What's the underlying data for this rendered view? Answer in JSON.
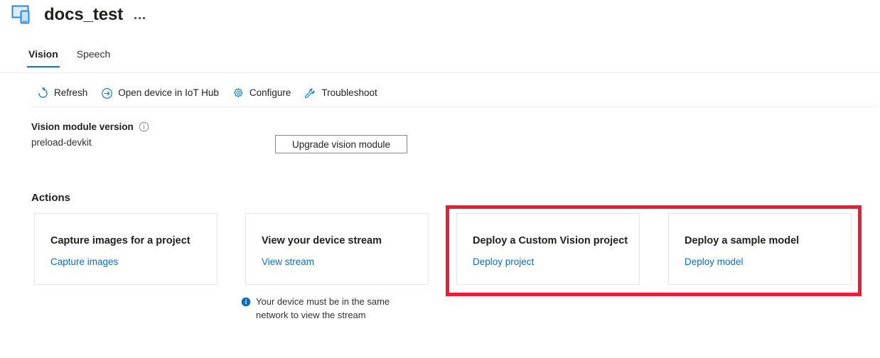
{
  "header": {
    "title": "docs_test",
    "icon": "device-screens-icon",
    "overflow_menu_label": "..."
  },
  "tabs": [
    {
      "label": "Vision",
      "active": true
    },
    {
      "label": "Speech",
      "active": false
    }
  ],
  "commandbar": [
    {
      "label": "Refresh",
      "icon": "refresh-icon"
    },
    {
      "label": "Open device in IoT Hub",
      "icon": "arrow-right-circle-icon"
    },
    {
      "label": "Configure",
      "icon": "gear-icon"
    },
    {
      "label": "Troubleshoot",
      "icon": "wrench-icon"
    }
  ],
  "version_section": {
    "label": "Vision module version",
    "info_icon": "info-outline-icon",
    "value": "preload-devkit",
    "upgrade_button": "Upgrade vision module"
  },
  "actions": {
    "heading": "Actions",
    "cards": [
      {
        "title": "Capture images for a project",
        "link": "Capture images"
      },
      {
        "title": "View your device stream",
        "link": "View stream"
      },
      {
        "title": "Deploy a Custom Vision project",
        "link": "Deploy project"
      },
      {
        "title": "Deploy a sample model",
        "link": "Deploy model"
      }
    ]
  },
  "info_note": {
    "icon": "info-filled-icon",
    "text": "Your device must be in the same network to view the stream"
  },
  "colors": {
    "accent": "#0078d4",
    "link": "#0f6cbd",
    "highlight": "#ed1b34",
    "text": "#201f1e",
    "border": "#e6e4e2"
  }
}
